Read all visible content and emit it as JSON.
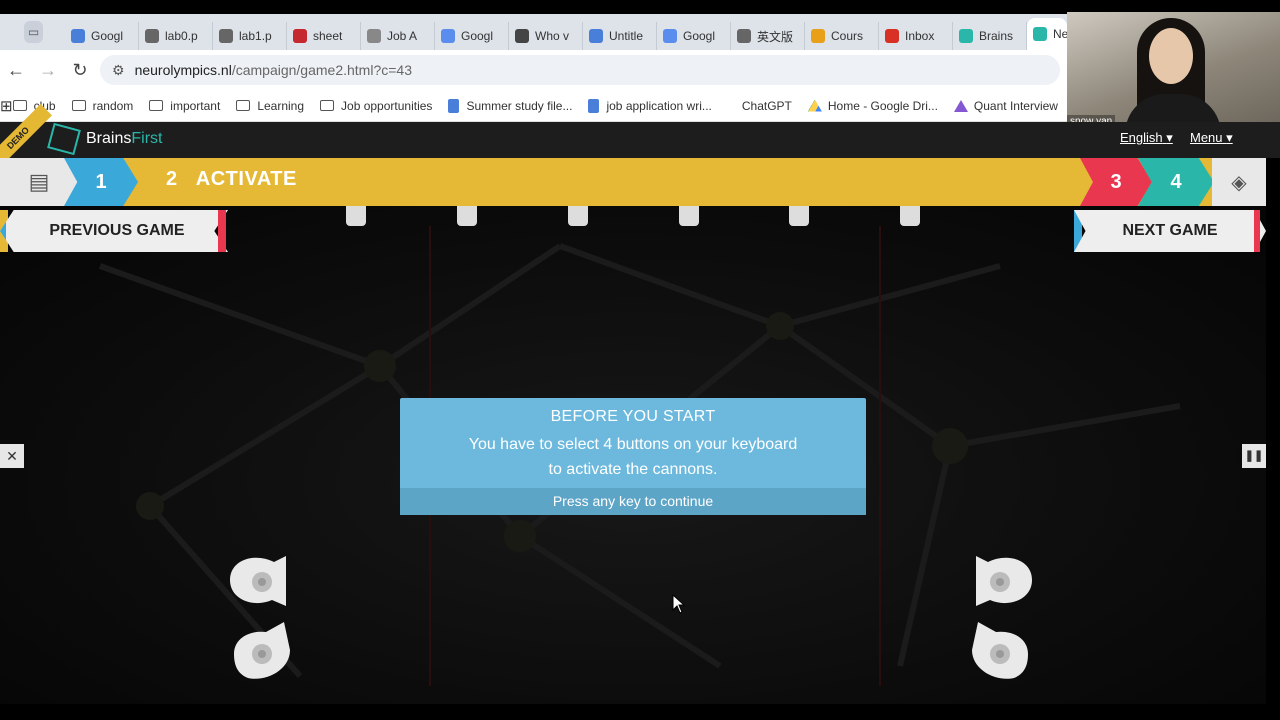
{
  "browser": {
    "tabs": [
      {
        "label": "Googl",
        "icon": "google-sites-icon",
        "color": "#4a7fd9"
      },
      {
        "label": "lab0.p",
        "icon": "globe-icon",
        "color": "#666666"
      },
      {
        "label": "lab1.p",
        "icon": "globe-icon",
        "color": "#666666"
      },
      {
        "label": "sheet",
        "icon": "pdf-icon",
        "color": "#c5282f"
      },
      {
        "label": "Job A",
        "icon": "git-icon",
        "color": "#888888"
      },
      {
        "label": "Googl",
        "icon": "gemini-icon",
        "color": "#5b8def"
      },
      {
        "label": "Who v",
        "icon": "google-icon",
        "color": "#444444"
      },
      {
        "label": "Untitle",
        "icon": "docs-icon",
        "color": "#4a7fd9"
      },
      {
        "label": "Googl",
        "icon": "gemini-icon",
        "color": "#5b8def"
      },
      {
        "label": "英文版",
        "icon": "globe-icon",
        "color": "#666666"
      },
      {
        "label": "Cours",
        "icon": "coursera-icon",
        "color": "#e8a019"
      },
      {
        "label": "Inbox",
        "icon": "gmail-icon",
        "color": "#d93025"
      },
      {
        "label": "Brains",
        "icon": "brainsfirst-icon",
        "color": "#2ab7a9"
      },
      {
        "label": "Ne",
        "icon": "brainsfirst-icon",
        "color": "#2ab7a9",
        "active": true
      }
    ],
    "url_host": "neurolympics.nl",
    "url_path": "/campaign/game2.html?c=43",
    "bookmarks": [
      {
        "label": "club",
        "icon": "folder-icon"
      },
      {
        "label": "random",
        "icon": "folder-icon"
      },
      {
        "label": "important",
        "icon": "folder-icon"
      },
      {
        "label": "Learning",
        "icon": "folder-icon"
      },
      {
        "label": "Job opportunities",
        "icon": "folder-icon"
      },
      {
        "label": "Summer study file...",
        "icon": "docs-icon"
      },
      {
        "label": "job application wri...",
        "icon": "docs-icon"
      },
      {
        "label": "ChatGPT",
        "icon": "openai-icon"
      },
      {
        "label": "Home - Google Dri...",
        "icon": "drive-icon"
      },
      {
        "label": "Quant Interview",
        "icon": "triangle-icon"
      }
    ]
  },
  "webcam": {
    "name": "snow yan"
  },
  "site": {
    "demo": "DEMO",
    "logo_a": "Brains",
    "logo_b": "First",
    "language": "English",
    "menu": "Menu"
  },
  "steps": {
    "one": "1",
    "two_num": "2",
    "two_label": "ACTIVATE",
    "three": "3",
    "four": "4"
  },
  "game": {
    "prev": "PREVIOUS GAME",
    "next": "NEXT GAME",
    "dialog_title": "BEFORE YOU START",
    "dialog_line1": "You have to select 4 buttons on your keyboard",
    "dialog_line2": "to activate the cannons.",
    "dialog_cta": "Press any key to continue",
    "close": "✕",
    "pause": "❚❚"
  },
  "colors": {
    "accent_teal": "#2ab7a9",
    "step_yellow": "#e5b935",
    "step_blue": "#3aa8d8",
    "step_red": "#e8374f",
    "dialog_blue": "#6db9dd"
  }
}
